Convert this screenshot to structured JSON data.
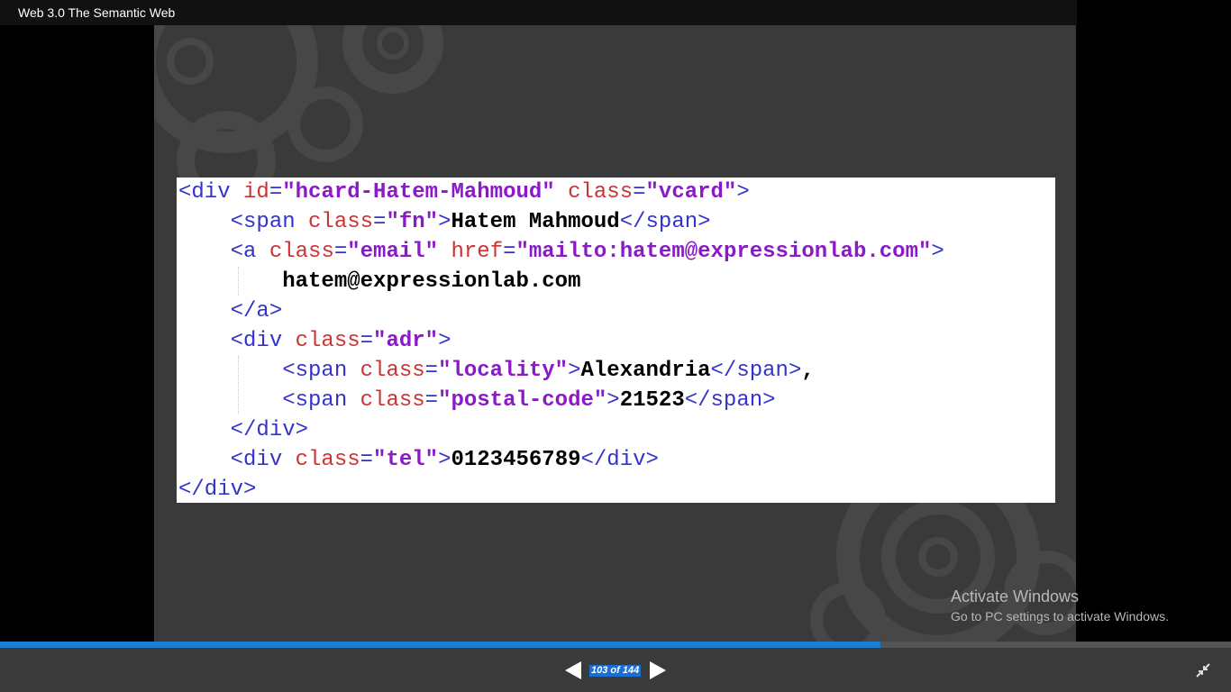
{
  "window": {
    "title": "Web 3.0 The Semantic Web"
  },
  "slide": {
    "code_lines": [
      [
        [
          "t",
          "<div "
        ],
        [
          "a",
          "id"
        ],
        [
          "t",
          "="
        ],
        [
          "v",
          "\"hcard-Hatem-Mahmoud\""
        ],
        [
          "t",
          " "
        ],
        [
          "a",
          "class"
        ],
        [
          "t",
          "="
        ],
        [
          "v",
          "\"vcard\""
        ],
        [
          "t",
          ">"
        ]
      ],
      [
        [
          "p",
          "    "
        ],
        [
          "t",
          "<span "
        ],
        [
          "a",
          "class"
        ],
        [
          "t",
          "="
        ],
        [
          "v",
          "\"fn\""
        ],
        [
          "t",
          ">"
        ],
        [
          "x",
          "Hatem Mahmoud"
        ],
        [
          "t",
          "</span>"
        ]
      ],
      [
        [
          "p",
          "    "
        ],
        [
          "t",
          "<a "
        ],
        [
          "a",
          "class"
        ],
        [
          "t",
          "="
        ],
        [
          "v",
          "\"email\""
        ],
        [
          "t",
          " "
        ],
        [
          "a",
          "href"
        ],
        [
          "t",
          "="
        ],
        [
          "v",
          "\"mailto:hatem@expressionlab.com\""
        ],
        [
          "t",
          ">"
        ]
      ],
      [
        [
          "p",
          "        "
        ],
        [
          "x",
          "hatem@expressionlab.com"
        ]
      ],
      [
        [
          "p",
          "    "
        ],
        [
          "t",
          "</a>"
        ]
      ],
      [
        [
          "p",
          "    "
        ],
        [
          "t",
          "<div "
        ],
        [
          "a",
          "class"
        ],
        [
          "t",
          "="
        ],
        [
          "v",
          "\"adr\""
        ],
        [
          "t",
          ">"
        ]
      ],
      [
        [
          "p",
          "        "
        ],
        [
          "t",
          "<span "
        ],
        [
          "a",
          "class"
        ],
        [
          "t",
          "="
        ],
        [
          "v",
          "\"locality\""
        ],
        [
          "t",
          ">"
        ],
        [
          "x",
          "Alexandria"
        ],
        [
          "t",
          "</span>"
        ],
        [
          "x",
          ","
        ]
      ],
      [
        [
          "p",
          "        "
        ],
        [
          "t",
          "<span "
        ],
        [
          "a",
          "class"
        ],
        [
          "t",
          "="
        ],
        [
          "v",
          "\"postal-code\""
        ],
        [
          "t",
          ">"
        ],
        [
          "x",
          "21523"
        ],
        [
          "t",
          "</span>"
        ]
      ],
      [
        [
          "p",
          "    "
        ],
        [
          "t",
          "</div>"
        ]
      ],
      [
        [
          "p",
          "    "
        ],
        [
          "t",
          "<div "
        ],
        [
          "a",
          "class"
        ],
        [
          "t",
          "="
        ],
        [
          "v",
          "\"tel\""
        ],
        [
          "t",
          ">"
        ],
        [
          "x",
          "0123456789"
        ],
        [
          "t",
          "</div>"
        ]
      ],
      [
        [
          "t",
          "</div>"
        ]
      ]
    ]
  },
  "watermark": {
    "title": "Activate Windows",
    "subtitle": "Go to PC settings to activate Windows."
  },
  "progress": {
    "fraction": 0.7153
  },
  "nav": {
    "prev_icon": "triangle-left-icon",
    "next_icon": "triangle-right-icon",
    "page_label": "103 of 144",
    "collapse_icon": "collapse-arrows-icon"
  },
  "colors": {
    "tag": "#3333cc",
    "attribute": "#cc3333",
    "value": "#8a1ac7",
    "text": "#000000",
    "progress": "#1a7fd0",
    "page_badge": "#1a6fd0"
  }
}
